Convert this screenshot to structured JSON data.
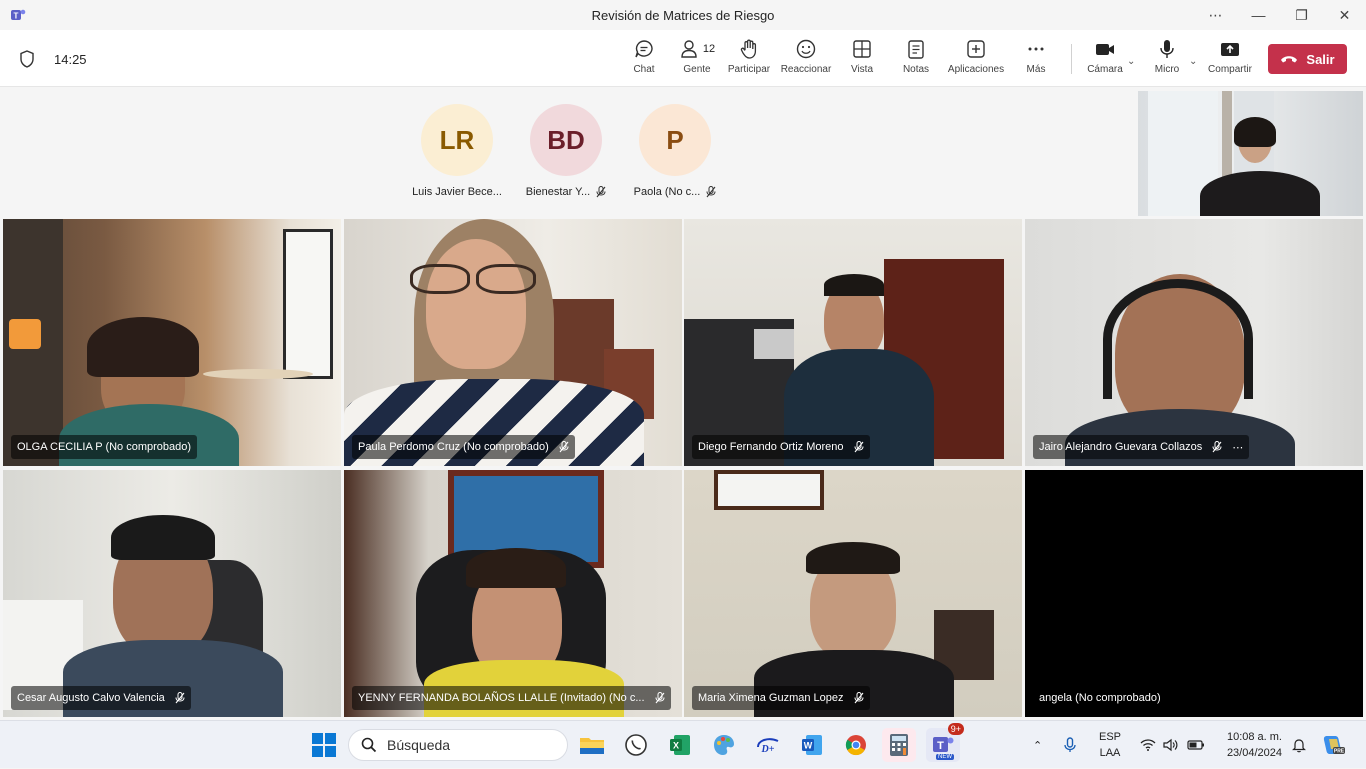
{
  "window": {
    "title": "Revisión de Matrices de Riesgo",
    "controls": [
      "more-icon",
      "minimize-icon",
      "maximize-icon",
      "close-icon"
    ]
  },
  "toolbar": {
    "timer": "14:25",
    "buttons": [
      {
        "id": "chat",
        "label": "Chat",
        "icon": "chat-icon"
      },
      {
        "id": "people",
        "label": "Gente",
        "icon": "people-icon",
        "count": "12"
      },
      {
        "id": "raise",
        "label": "Participar",
        "icon": "raise-hand-icon"
      },
      {
        "id": "react",
        "label": "Reaccionar",
        "icon": "smile-icon"
      },
      {
        "id": "view",
        "label": "Vista",
        "icon": "grid-icon"
      },
      {
        "id": "notes",
        "label": "Notas",
        "icon": "notes-icon"
      },
      {
        "id": "apps",
        "label": "Aplicaciones",
        "icon": "add-app-icon"
      },
      {
        "id": "more",
        "label": "Más",
        "icon": "more-icon"
      },
      {
        "id": "camera",
        "label": "Cámara",
        "icon": "camera-icon"
      },
      {
        "id": "mic",
        "label": "Micro",
        "icon": "mic-icon"
      },
      {
        "id": "share",
        "label": "Compartir",
        "icon": "share-icon"
      }
    ],
    "leave_label": "Salir"
  },
  "audio_participants": [
    {
      "initials": "LR",
      "name": "Luis Javier Bece...",
      "bg": "#fbeed3",
      "fg": "#8a5a00",
      "muted": false
    },
    {
      "initials": "BD",
      "name": "Bienestar Y...",
      "bg": "#f1d9dc",
      "fg": "#6b1f2a",
      "muted": true
    },
    {
      "initials": "P",
      "name": "Paola (No c...",
      "bg": "#fbe7d5",
      "fg": "#8a4d12",
      "muted": true
    }
  ],
  "video_tiles": [
    {
      "name": "OLGA CECILIA P (No comprobado)",
      "muted": false,
      "more": false
    },
    {
      "name": "Paula Perdomo Cruz (No comprobado)",
      "muted": true,
      "more": false
    },
    {
      "name": "Diego Fernando Ortiz Moreno",
      "muted": true,
      "more": false
    },
    {
      "name": "Jairo Alejandro Guevara Collazos",
      "muted": true,
      "more": true
    },
    {
      "name": "Cesar Augusto Calvo Valencia",
      "muted": true,
      "more": false
    },
    {
      "name": "YENNY FERNANDA BOLAÑOS LLALLE (Invitado) (No c...",
      "muted": true,
      "more": false
    },
    {
      "name": "Maria Ximena Guzman Lopez",
      "muted": true,
      "more": false
    },
    {
      "name": "angela (No comprobado)",
      "muted": false,
      "more": false
    }
  ],
  "taskbar": {
    "search_placeholder": "Búsqueda",
    "apps": [
      "file-explorer-icon",
      "whatsapp-icon",
      "excel-icon",
      "paint-icon",
      "disney-icon",
      "word-icon",
      "chrome-icon",
      "calculator-icon",
      "teams-icon"
    ],
    "teams_badge": "9+",
    "language": "ESP",
    "language_sub": "LAA",
    "time": "10:08 a. m.",
    "date": "23/04/2024"
  }
}
